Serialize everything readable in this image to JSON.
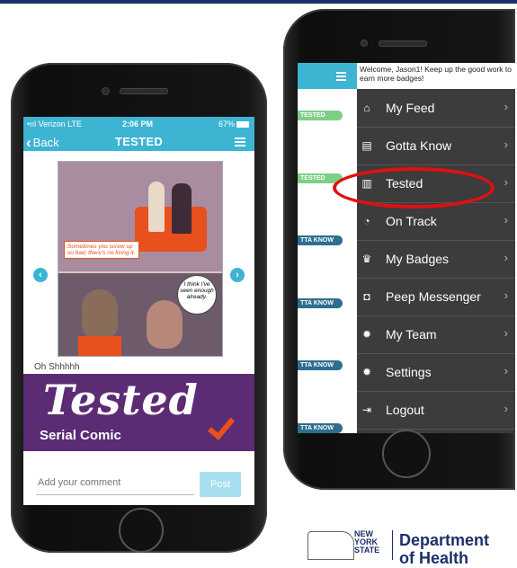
{
  "left_phone": {
    "status": {
      "carrier": "•ııl Verizon  LTE",
      "time": "2:06 PM",
      "battery": "67%"
    },
    "nav": {
      "back_label": "Back",
      "title": "TESTED"
    },
    "comic": {
      "speech1": "Sometimes you screw up so bad, there's no fixing it.",
      "speech2": "I think I've seen enough already."
    },
    "caption": "Oh Shhhhh",
    "banner": {
      "title": "Tested",
      "subtitle": "Serial Comic"
    },
    "comment": {
      "placeholder": "Add your comment",
      "post_label": "Post"
    }
  },
  "right_phone": {
    "welcome": "Welcome, Jason1! Keep up the good work to earn more badges!",
    "tags": [
      "TESTED",
      "TESTED",
      "TTA KNOW",
      "TTA KNOW",
      "TTA KNOW",
      "TTA KNOW"
    ],
    "menu": [
      {
        "label": "My Feed",
        "icon": "home-icon"
      },
      {
        "label": "Gotta Know",
        "icon": "document-icon"
      },
      {
        "label": "Tested",
        "icon": "book-icon"
      },
      {
        "label": "On Track",
        "icon": "clock-icon"
      },
      {
        "label": "My Badges",
        "icon": "badge-icon"
      },
      {
        "label": "Peep Messenger",
        "icon": "chat-icon"
      },
      {
        "label": "My Team",
        "icon": "gear-icon"
      },
      {
        "label": "Settings",
        "icon": "gear-icon"
      },
      {
        "label": "Logout",
        "icon": "logout-icon"
      }
    ]
  },
  "logo": {
    "line1": "NEW",
    "line2": "YORK",
    "line3": "STATE",
    "dept1": "Department",
    "dept2": "of Health"
  },
  "colors": {
    "accent": "#3eb4d3",
    "banner": "#5b2b73",
    "highlight": "#e01010",
    "drawer": "#3c3c3c"
  }
}
